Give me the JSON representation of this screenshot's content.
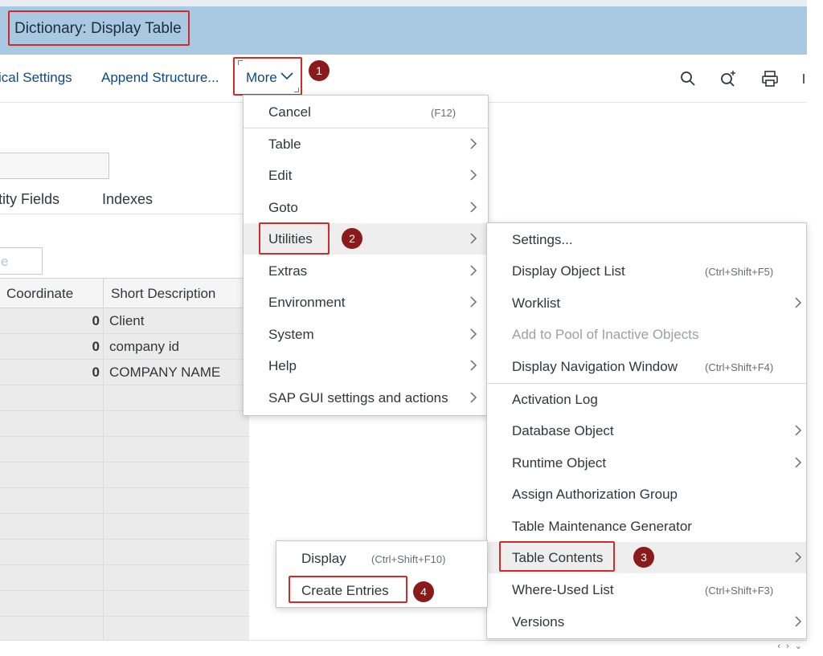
{
  "app": {
    "title": "Dictionary: Display Table"
  },
  "toolbar": {
    "technical_settings": "ical Settings",
    "append_structure": "Append Structure...",
    "more_label": "More",
    "icons": [
      "search-icon",
      "search-plus-icon",
      "print-icon"
    ]
  },
  "tabs": [
    {
      "label": "tity Fields"
    },
    {
      "label": "Indexes"
    }
  ],
  "filter_placeholder": "e",
  "grid": {
    "columns": [
      "Coordinate",
      "Short Description"
    ],
    "rows": [
      {
        "coord": "0",
        "desc": "Client"
      },
      {
        "coord": "0",
        "desc": "company id"
      },
      {
        "coord": "0",
        "desc": "COMPANY NAME"
      }
    ]
  },
  "more_menu": {
    "items": [
      {
        "label": "Cancel",
        "shortcut": "(F12)",
        "submenu": false
      },
      {
        "label": "Table",
        "shortcut": "",
        "submenu": true
      },
      {
        "label": "Edit",
        "shortcut": "",
        "submenu": true
      },
      {
        "label": "Goto",
        "shortcut": "",
        "submenu": true
      },
      {
        "label": "Utilities",
        "shortcut": "",
        "submenu": true
      },
      {
        "label": "Extras",
        "shortcut": "",
        "submenu": true
      },
      {
        "label": "Environment",
        "shortcut": "",
        "submenu": true
      },
      {
        "label": "System",
        "shortcut": "",
        "submenu": true
      },
      {
        "label": "Help",
        "shortcut": "",
        "submenu": true
      },
      {
        "label": "SAP GUI settings and actions",
        "shortcut": "",
        "submenu": true
      }
    ]
  },
  "utilities_menu": {
    "items": [
      {
        "label": "Settings...",
        "shortcut": "",
        "submenu": false
      },
      {
        "label": "Display Object List",
        "shortcut": "(Ctrl+Shift+F5)",
        "submenu": false
      },
      {
        "label": "Worklist",
        "shortcut": "",
        "submenu": true
      },
      {
        "label": "Add to Pool of Inactive Objects",
        "shortcut": "",
        "submenu": false,
        "disabled": true
      },
      {
        "label": "Display Navigation Window",
        "shortcut": "(Ctrl+Shift+F4)",
        "submenu": false
      },
      {
        "label": "Activation Log",
        "shortcut": "",
        "submenu": false
      },
      {
        "label": "Database Object",
        "shortcut": "",
        "submenu": true
      },
      {
        "label": "Runtime Object",
        "shortcut": "",
        "submenu": true
      },
      {
        "label": "Assign Authorization Group",
        "shortcut": "",
        "submenu": false
      },
      {
        "label": "Table Maintenance Generator",
        "shortcut": "",
        "submenu": false
      },
      {
        "label": "Table Contents",
        "shortcut": "",
        "submenu": true
      },
      {
        "label": "Where-Used List",
        "shortcut": "(Ctrl+Shift+F3)",
        "submenu": false
      },
      {
        "label": "Versions",
        "shortcut": "",
        "submenu": true
      }
    ]
  },
  "table_contents_menu": {
    "items": [
      {
        "label": "Display",
        "shortcut": "(Ctrl+Shift+F10)"
      },
      {
        "label": "Create Entries",
        "shortcut": ""
      }
    ]
  },
  "steps": [
    "1",
    "2",
    "3",
    "4"
  ],
  "colors": {
    "title_bar": "#a9c8e1",
    "link_blue": "#0a4a8a",
    "highlight_red": "#d22b2b",
    "step_badge": "#8b1a1a"
  },
  "scroll_arrows": "‹ › ⌄"
}
